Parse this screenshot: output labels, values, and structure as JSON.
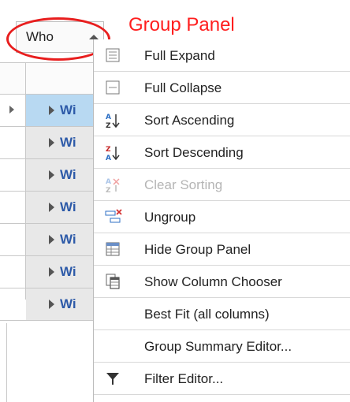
{
  "group_panel": {
    "column_tag": "Who",
    "annotation": "Group Panel"
  },
  "grid": {
    "rows": [
      {
        "text": "Wi",
        "selected": true
      },
      {
        "text": "Wi",
        "selected": false
      },
      {
        "text": "Wi",
        "selected": false
      },
      {
        "text": "Wi",
        "selected": false
      },
      {
        "text": "Wi",
        "selected": false
      },
      {
        "text": "Wi",
        "selected": false
      },
      {
        "text": "Wi",
        "selected": false
      }
    ]
  },
  "menu": {
    "items": [
      {
        "label": "Full Expand",
        "icon": "full-expand-icon",
        "enabled": true
      },
      {
        "label": "Full Collapse",
        "icon": "full-collapse-icon",
        "enabled": true
      },
      {
        "label": "Sort Ascending",
        "icon": "sort-ascending-icon",
        "enabled": true
      },
      {
        "label": "Sort Descending",
        "icon": "sort-descending-icon",
        "enabled": true
      },
      {
        "label": "Clear Sorting",
        "icon": "clear-sorting-icon",
        "enabled": false
      },
      {
        "label": "Ungroup",
        "icon": "ungroup-icon",
        "enabled": true
      },
      {
        "label": "Hide Group Panel",
        "icon": "hide-group-panel-icon",
        "enabled": true
      },
      {
        "label": "Show Column Chooser",
        "icon": "column-chooser-icon",
        "enabled": true
      },
      {
        "label": "Best Fit (all columns)",
        "icon": "",
        "enabled": true
      },
      {
        "label": "Group Summary Editor...",
        "icon": "",
        "enabled": true
      },
      {
        "label": "Filter Editor...",
        "icon": "filter-icon",
        "enabled": true
      }
    ]
  },
  "colors": {
    "annotation": "#ff1e1e",
    "row_link": "#2d5aa8",
    "selected_row": "#b8d9f2"
  }
}
